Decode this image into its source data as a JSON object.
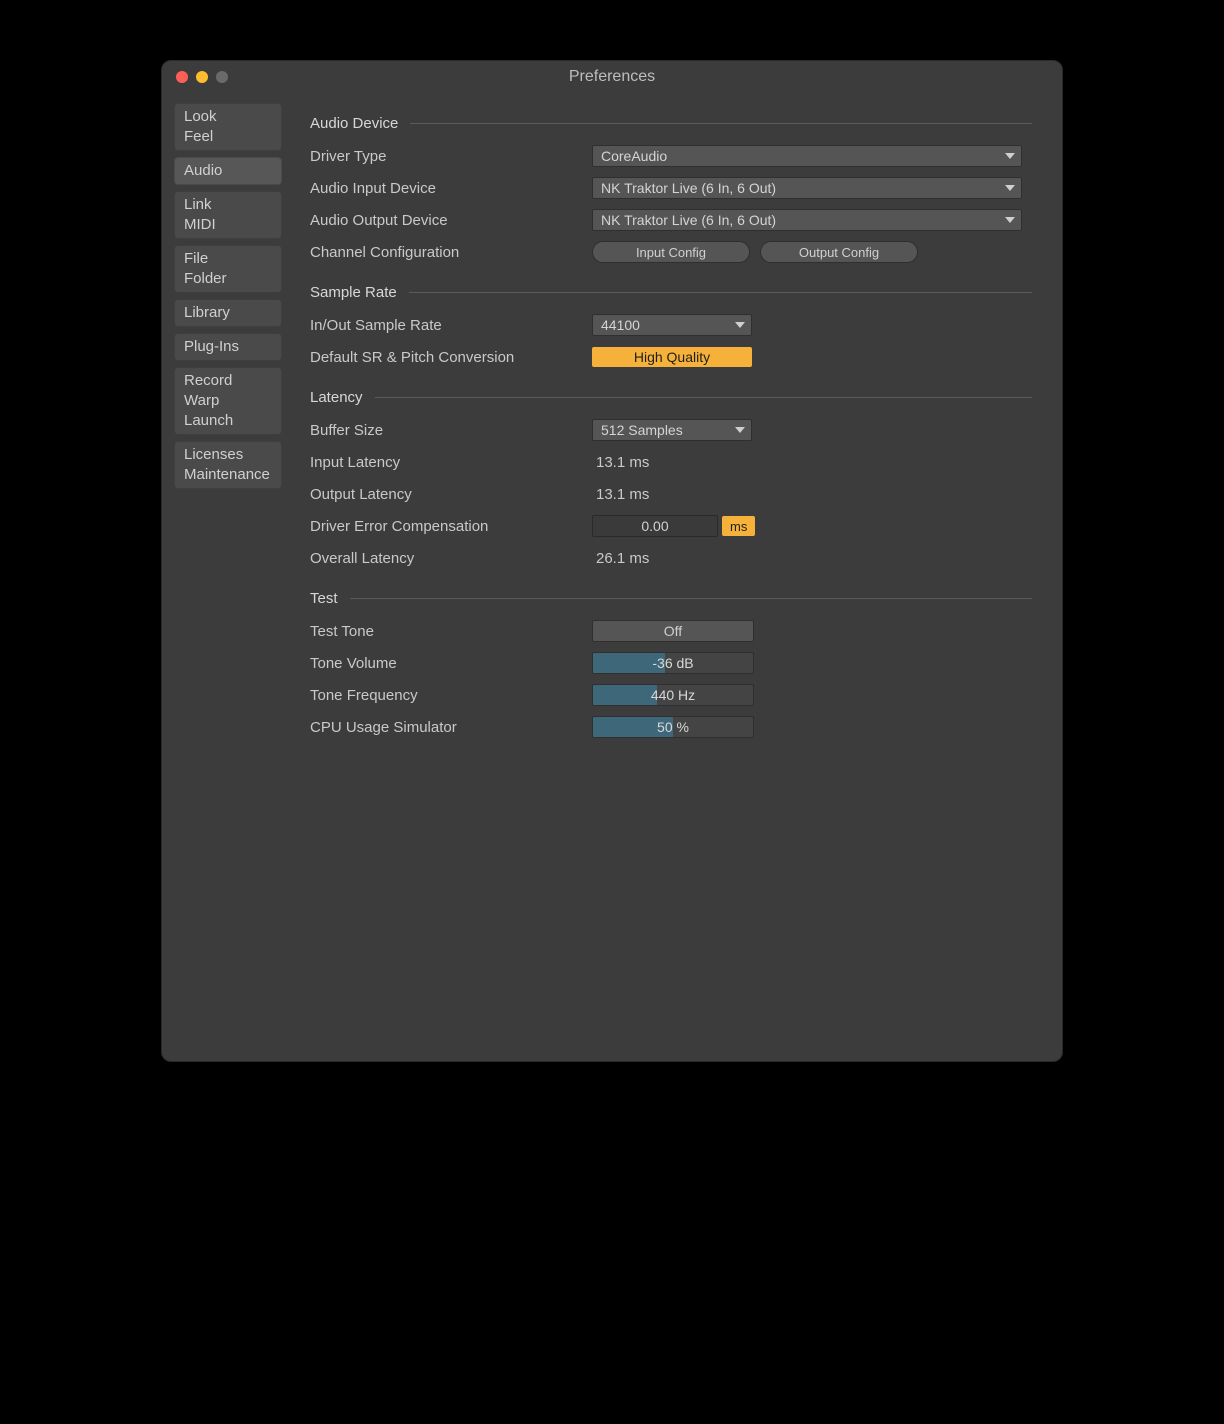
{
  "window": {
    "title": "Preferences"
  },
  "sidebar": {
    "groups": [
      {
        "items": [
          "Look",
          "Feel"
        ],
        "active": false
      },
      {
        "items": [
          "Audio"
        ],
        "active": true
      },
      {
        "items": [
          "Link",
          "MIDI"
        ],
        "active": false
      },
      {
        "items": [
          "File",
          "Folder"
        ],
        "active": false
      },
      {
        "items": [
          "Library"
        ],
        "active": false
      },
      {
        "items": [
          "Plug-Ins"
        ],
        "active": false
      },
      {
        "items": [
          "Record",
          "Warp",
          "Launch"
        ],
        "active": false
      },
      {
        "items": [
          "Licenses",
          "Maintenance"
        ],
        "active": false
      }
    ]
  },
  "sections": {
    "audio_device": {
      "header": "Audio Device",
      "driver_type_label": "Driver Type",
      "driver_type_value": "CoreAudio",
      "input_device_label": "Audio Input Device",
      "input_device_value": "NK Traktor Live (6 In, 6 Out)",
      "output_device_label": "Audio Output Device",
      "output_device_value": "NK Traktor Live (6 In, 6 Out)",
      "channel_config_label": "Channel Configuration",
      "input_config_btn": "Input Config",
      "output_config_btn": "Output Config"
    },
    "sample_rate": {
      "header": "Sample Rate",
      "inout_label": "In/Out Sample Rate",
      "inout_value": "44100",
      "default_sr_label": "Default SR & Pitch Conversion",
      "default_sr_value": "High Quality"
    },
    "latency": {
      "header": "Latency",
      "buffer_label": "Buffer Size",
      "buffer_value": "512 Samples",
      "input_latency_label": "Input Latency",
      "input_latency_value": "13.1 ms",
      "output_latency_label": "Output Latency",
      "output_latency_value": "13.1 ms",
      "driver_comp_label": "Driver Error Compensation",
      "driver_comp_value": "0.00",
      "driver_comp_unit": "ms",
      "overall_label": "Overall Latency",
      "overall_value": "26.1 ms"
    },
    "test": {
      "header": "Test",
      "test_tone_label": "Test Tone",
      "test_tone_value": "Off",
      "tone_volume_label": "Tone Volume",
      "tone_volume_value": "-36 dB",
      "tone_volume_fill_pct": 45,
      "tone_freq_label": "Tone Frequency",
      "tone_freq_value": "440 Hz",
      "tone_freq_fill_pct": 40,
      "cpu_label": "CPU Usage Simulator",
      "cpu_value": "50 %",
      "cpu_fill_pct": 50
    }
  }
}
